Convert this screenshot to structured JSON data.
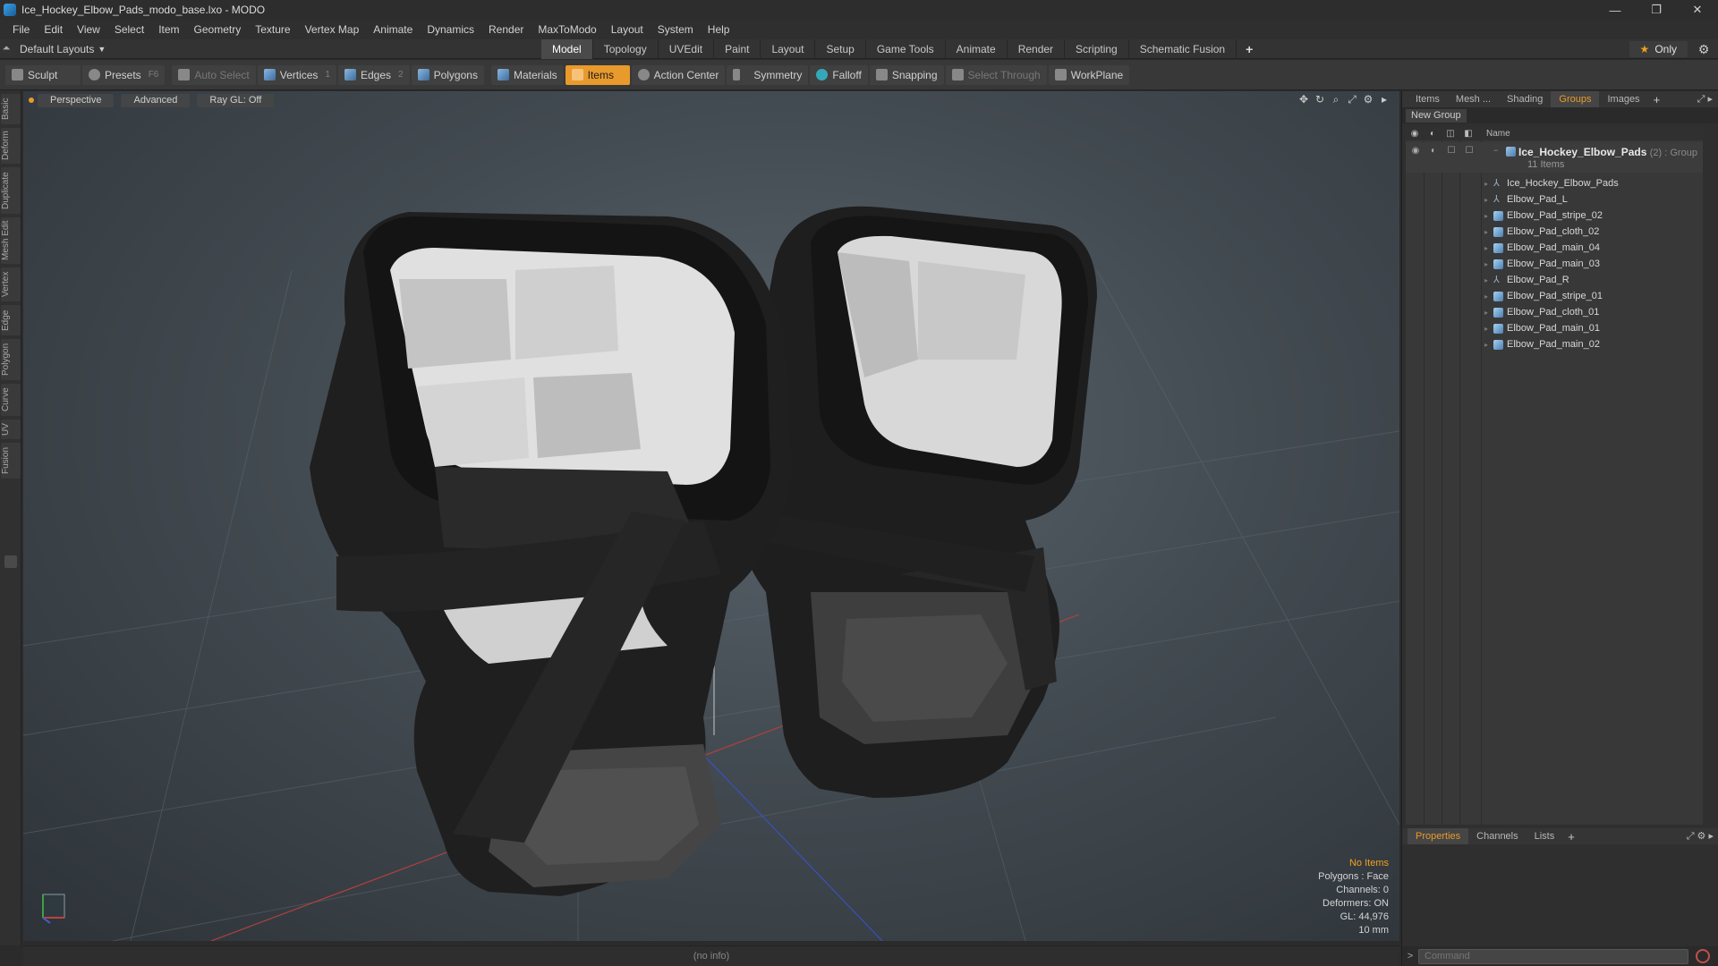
{
  "window": {
    "title": "Ice_Hockey_Elbow_Pads_modo_base.lxo - MODO",
    "controls": [
      "—",
      "❐",
      "✕"
    ]
  },
  "menu": [
    "File",
    "Edit",
    "View",
    "Select",
    "Item",
    "Geometry",
    "Texture",
    "Vertex Map",
    "Animate",
    "Dynamics",
    "Render",
    "MaxToModo",
    "Layout",
    "System",
    "Help"
  ],
  "layout": {
    "selector": "Default Layouts",
    "tabs": [
      "Model",
      "Topology",
      "UVEdit",
      "Paint",
      "Layout",
      "Setup",
      "Game Tools",
      "Animate",
      "Render",
      "Scripting",
      "Schematic Fusion"
    ],
    "active_tab": "Model",
    "add": "+",
    "only_label": "Only"
  },
  "toolbar": {
    "sculpt": "Sculpt",
    "presets": "Presets",
    "presets_key": "F6",
    "auto_select": "Auto Select",
    "vertices": "Vertices",
    "vertices_key": "1",
    "edges": "Edges",
    "edges_key": "2",
    "polygons": "Polygons",
    "materials": "Materials",
    "items": "Items",
    "action_center": "Action Center",
    "symmetry": "Symmetry",
    "falloff": "Falloff",
    "snapping": "Snapping",
    "select_through": "Select Through",
    "workplane": "WorkPlane"
  },
  "left_tabs": [
    "Basic",
    "Deform",
    "Duplicate",
    "Mesh Edit",
    "Vertex",
    "Edge",
    "Polygon",
    "Curve",
    "UV",
    "Fusion"
  ],
  "viewport": {
    "view": "Perspective",
    "shading": "Advanced",
    "raygl": "Ray GL: Off",
    "info": {
      "selection": "No Items",
      "polygons": "Polygons : Face",
      "channels": "Channels: 0",
      "deformers": "Deformers: ON",
      "gl": "GL: 44,976",
      "unit": "10 mm"
    }
  },
  "status": "(no info)",
  "right_panel": {
    "tabs": [
      "Items",
      "Mesh ...",
      "Shading",
      "Groups",
      "Images"
    ],
    "active_tab": "Groups",
    "new_group": "New Group",
    "column_name": "Name",
    "group": {
      "name": "Ice_Hockey_Elbow_Pads",
      "count": "(2) : Group",
      "sub": "11 Items"
    },
    "items": [
      {
        "name": "Ice_Hockey_Elbow_Pads",
        "type": "locator"
      },
      {
        "name": "Elbow_Pad_L",
        "type": "locator"
      },
      {
        "name": "Elbow_Pad_stripe_02",
        "type": "mesh"
      },
      {
        "name": "Elbow_Pad_cloth_02",
        "type": "mesh"
      },
      {
        "name": "Elbow_Pad_main_04",
        "type": "mesh"
      },
      {
        "name": "Elbow_Pad_main_03",
        "type": "mesh"
      },
      {
        "name": "Elbow_Pad_R",
        "type": "locator"
      },
      {
        "name": "Elbow_Pad_stripe_01",
        "type": "mesh"
      },
      {
        "name": "Elbow_Pad_cloth_01",
        "type": "mesh"
      },
      {
        "name": "Elbow_Pad_main_01",
        "type": "mesh"
      },
      {
        "name": "Elbow_Pad_main_02",
        "type": "mesh"
      }
    ],
    "bottom_tabs": [
      "Properties",
      "Channels",
      "Lists"
    ],
    "bottom_active": "Properties",
    "command_placeholder": "Command"
  }
}
